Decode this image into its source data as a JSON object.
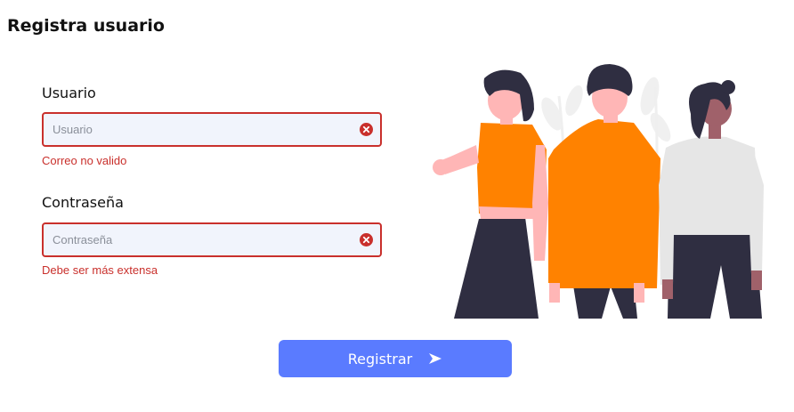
{
  "page": {
    "title": "Registra usuario"
  },
  "form": {
    "user": {
      "label": "Usuario",
      "placeholder": "Usuario",
      "value": "",
      "error": "Correo no valido"
    },
    "password": {
      "label": "Contraseña",
      "placeholder": "Contraseña",
      "value": "",
      "error": "Debe ser más extensa"
    },
    "submit_label": "Registrar"
  },
  "icons": {
    "error": "error-circle-icon",
    "submit": "arrow-right-icon"
  },
  "colors": {
    "error": "#c9302c",
    "input_background": "#f1f4fc",
    "button": "#5a7bff",
    "illustration_accent": "#ff8200",
    "illustration_dark": "#2f2e41",
    "illustration_skin": "#ffb6b6"
  }
}
